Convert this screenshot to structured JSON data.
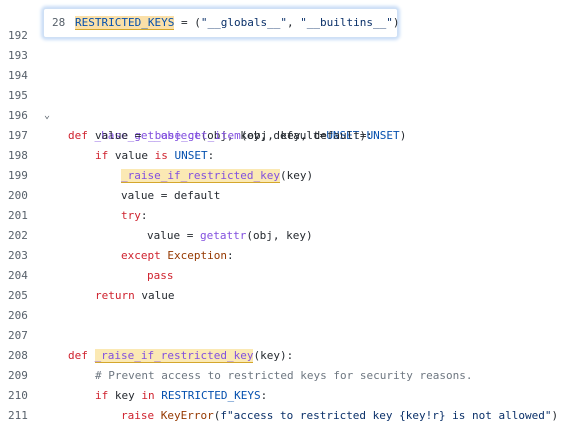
{
  "editor": {
    "lines": [
      {
        "n": "192"
      },
      {
        "n": "193"
      },
      {
        "n": "194"
      },
      {
        "n": "195"
      },
      {
        "n": "196"
      },
      {
        "n": "197"
      },
      {
        "n": "198"
      },
      {
        "n": "199"
      },
      {
        "n": "200"
      },
      {
        "n": "201"
      },
      {
        "n": "202"
      },
      {
        "n": "203"
      },
      {
        "n": "204"
      },
      {
        "n": "205"
      },
      {
        "n": "206"
      },
      {
        "n": "207"
      },
      {
        "n": "208"
      },
      {
        "n": "209"
      },
      {
        "n": "210"
      },
      {
        "n": "211"
      }
    ],
    "fold_glyph": "⌄",
    "tokens": {
      "def": "def",
      "base_get_object": "_base_get_object",
      "sig1": "(obj, key, default=",
      "unset": "UNSET",
      "close_colon": "):",
      "value": "value",
      "eq": " = ",
      "base_get_item": "_base_get_item",
      "sig2": "(obj, key, default=",
      "close": ")",
      "if": "if",
      "value_is": " value ",
      "is": "is",
      "colon": ":",
      "raise_if_restricted_key": "_raise_if_restricted_key",
      "key_arg": "(key)",
      "value_eq_default": "value = default",
      "try": "try",
      "value_eq": "value = ",
      "getattr": "getattr",
      "getattr_args": "(obj, key)",
      "except": "except",
      "exception": "Exception",
      "pass": "pass",
      "return": "return",
      "return_val": " value",
      "def_sig3": "(key):",
      "comment": "# Prevent access to restricted keys for security reasons.",
      "key": " key ",
      "in": "in",
      "restricted_keys_ref": "RESTRICTED_KEYS",
      "raise": "raise",
      "keyerror": "KeyError",
      "fstr": "f\"access to restricted key {key!r} is not allowed\"",
      "close_paren": ")"
    }
  },
  "peek_popup": {
    "line_number": "28",
    "name": "RESTRICTED_KEYS",
    "assign": " = (",
    "str1": "\"__globals__\"",
    "sep": ", ",
    "str2": "\"__builtins__\"",
    "close": ")"
  }
}
